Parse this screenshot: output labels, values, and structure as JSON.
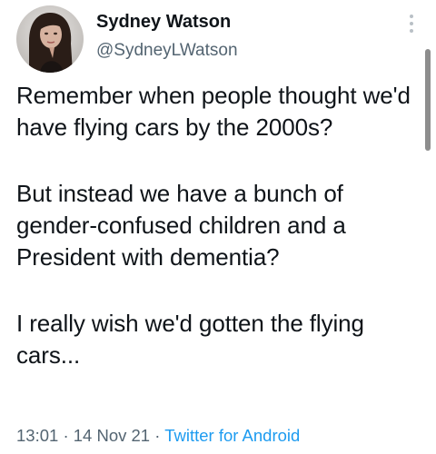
{
  "author": {
    "display_name": "Sydney Watson",
    "handle": "@SydneyLWatson"
  },
  "tweet": {
    "paragraphs": [
      "Remember when people thought we'd have flying cars by the 2000s?",
      "But instead we have a bunch of gender-confused children and a President with dementia?",
      "I really wish we'd gotten the flying cars..."
    ]
  },
  "meta": {
    "time": "13:01",
    "separator": "·",
    "date": "14 Nov 21",
    "source": "Twitter for Android"
  },
  "colors": {
    "text": "#0f1419",
    "secondary": "#536471",
    "link": "#1d9bf0"
  },
  "icons": {
    "more": "more-vertical-icon"
  }
}
